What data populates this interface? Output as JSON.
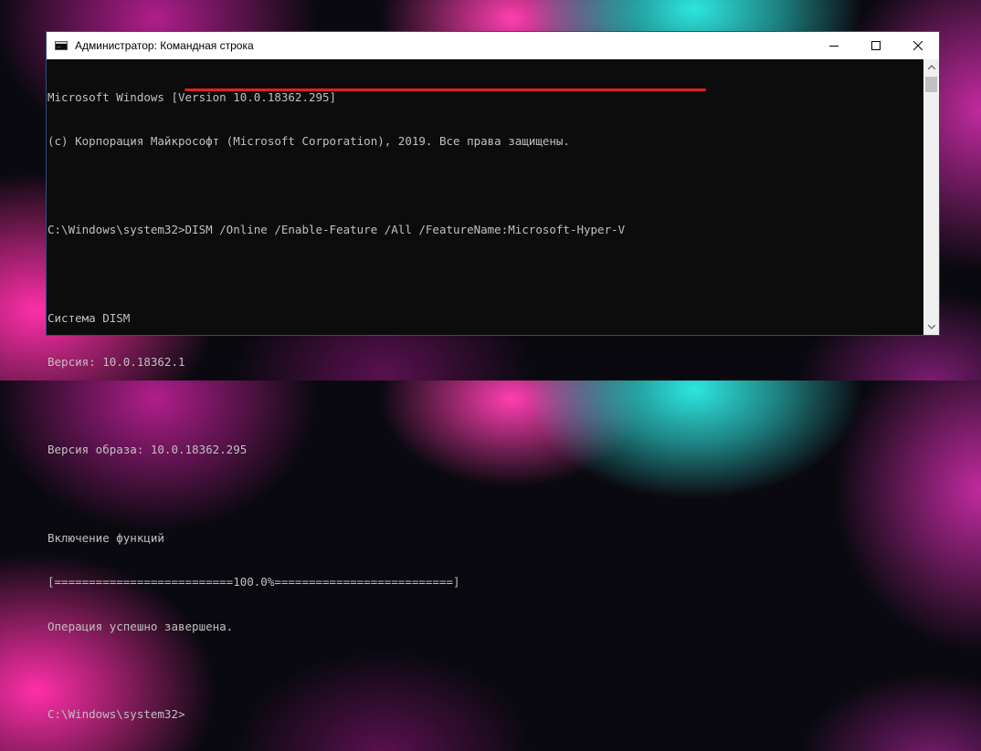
{
  "window": {
    "title": "Администратор: Командная строка",
    "icon": "cmd-icon",
    "controls": [
      "minimize-icon",
      "maximize-icon",
      "close-icon"
    ]
  },
  "console": {
    "lines": [
      "Microsoft Windows [Version 10.0.18362.295]",
      "(c) Корпорация Майкрософт (Microsoft Corporation), 2019. Все права защищены.",
      "",
      "C:\\Windows\\system32>DISM /Online /Enable-Feature /All /FeatureName:Microsoft-Hyper-V",
      "",
      "Cистема DISM",
      "Версия: 10.0.18362.1",
      "",
      "Версия образа: 10.0.18362.295",
      "",
      "Включение функций",
      "[==========================100.0%==========================]",
      "Операция успешно завершена.",
      "",
      "C:\\Windows\\system32>"
    ]
  },
  "colors": {
    "console_bg": "#0c0c0c",
    "console_text": "#c0c0c0",
    "highlight_underline": "#e02020"
  }
}
